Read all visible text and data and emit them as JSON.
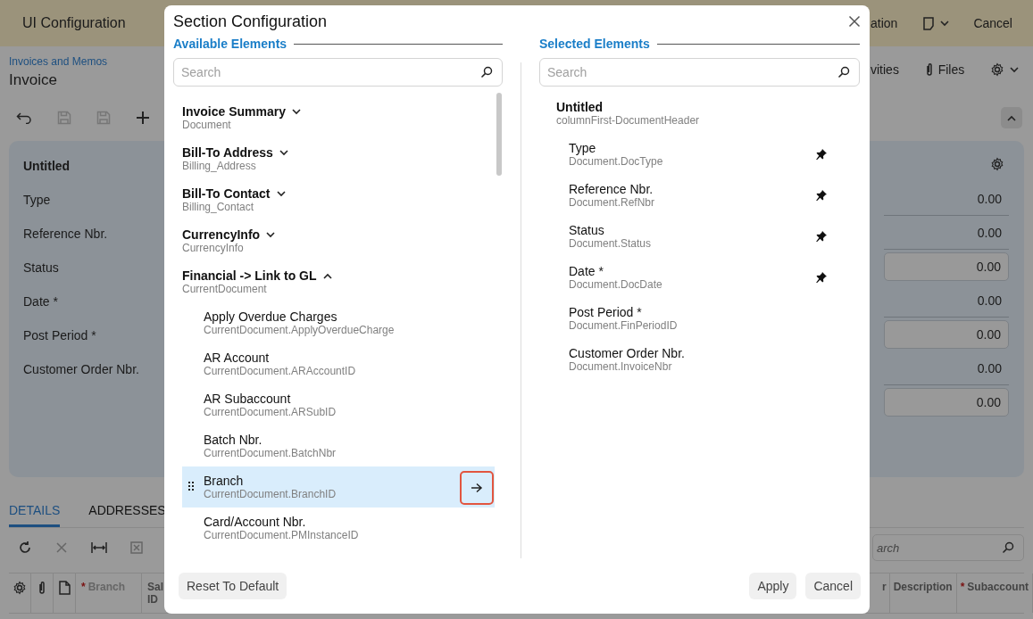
{
  "top_bar": {
    "title": "UI Configuration",
    "cut_action": "ation",
    "cancel": "Cancel"
  },
  "page_header": {
    "breadcrumb": "Invoices and Memos",
    "title": "Invoice",
    "cut_action": "vities",
    "files": "Files"
  },
  "summary_card": {
    "title": "Untitled",
    "labels": [
      "Type",
      "Reference Nbr.",
      "Status",
      "Date *",
      "Post Period *",
      "Customer Order Nbr."
    ],
    "values": [
      {
        "value": "0.00",
        "boxed": false
      },
      {
        "value": "0.00",
        "boxed": false
      },
      {
        "value": "0.00",
        "boxed": true
      },
      {
        "value": "0.00",
        "boxed": false
      },
      {
        "value": "0.00",
        "boxed": true
      },
      {
        "value": "0.00",
        "boxed": false
      },
      {
        "value": "0.00",
        "boxed": true
      }
    ]
  },
  "tabs": [
    {
      "label": "DETAILS",
      "selected": true
    },
    {
      "label": "ADDRESSES",
      "selected": false
    }
  ],
  "grid_search": {
    "placeholder": "arch"
  },
  "grid_columns_left": [
    {
      "marker": "*",
      "label": "Branch"
    },
    {
      "label": "Sal ID"
    }
  ],
  "grid_columns_right": [
    {
      "label": "r"
    },
    {
      "label": "Description"
    },
    {
      "marker": "*",
      "label": "Subaccount"
    }
  ],
  "dialog": {
    "title": "Section Configuration",
    "available": {
      "heading": "Available Elements",
      "search_placeholder": "Search",
      "groups": [
        {
          "label": "Invoice Summary",
          "field": "Document",
          "expanded": false
        },
        {
          "label": "Bill-To Address",
          "field": "Billing_Address",
          "expanded": false
        },
        {
          "label": "Bill-To Contact",
          "field": "Billing_Contact",
          "expanded": false
        },
        {
          "label": "CurrencyInfo",
          "field": "CurrencyInfo",
          "expanded": false
        },
        {
          "label": "Financial -> Link to GL",
          "field": "CurrentDocument",
          "expanded": true,
          "children": [
            {
              "label": "Apply Overdue Charges",
              "field": "CurrentDocument.ApplyOverdueCharge",
              "selected": false
            },
            {
              "label": "AR Account",
              "field": "CurrentDocument.ARAccountID",
              "selected": false
            },
            {
              "label": "AR Subaccount",
              "field": "CurrentDocument.ARSubID",
              "selected": false
            },
            {
              "label": "Batch Nbr.",
              "field": "CurrentDocument.BatchNbr",
              "selected": false
            },
            {
              "label": "Branch",
              "field": "CurrentDocument.BranchID",
              "selected": true
            },
            {
              "label": "Card/Account Nbr.",
              "field": "CurrentDocument.PMInstanceID",
              "selected": false
            }
          ]
        }
      ]
    },
    "selected": {
      "heading": "Selected Elements",
      "search_placeholder": "Search",
      "section": {
        "label": "Untitled",
        "field": "columnFirst-DocumentHeader",
        "children": [
          {
            "label": "Type",
            "field": "Document.DocType",
            "pinned": true
          },
          {
            "label": "Reference Nbr.",
            "field": "Document.RefNbr",
            "pinned": true
          },
          {
            "label": "Status",
            "field": "Document.Status",
            "pinned": true
          },
          {
            "label": "Date *",
            "field": "Document.DocDate",
            "pinned": true
          },
          {
            "label": "Post Period *",
            "field": "Document.FinPeriodID",
            "pinned": false
          },
          {
            "label": "Customer Order Nbr.",
            "field": "Document.InvoiceNbr",
            "pinned": false
          }
        ]
      }
    },
    "buttons": {
      "reset": "Reset To Default",
      "apply": "Apply",
      "cancel": "Cancel"
    }
  }
}
